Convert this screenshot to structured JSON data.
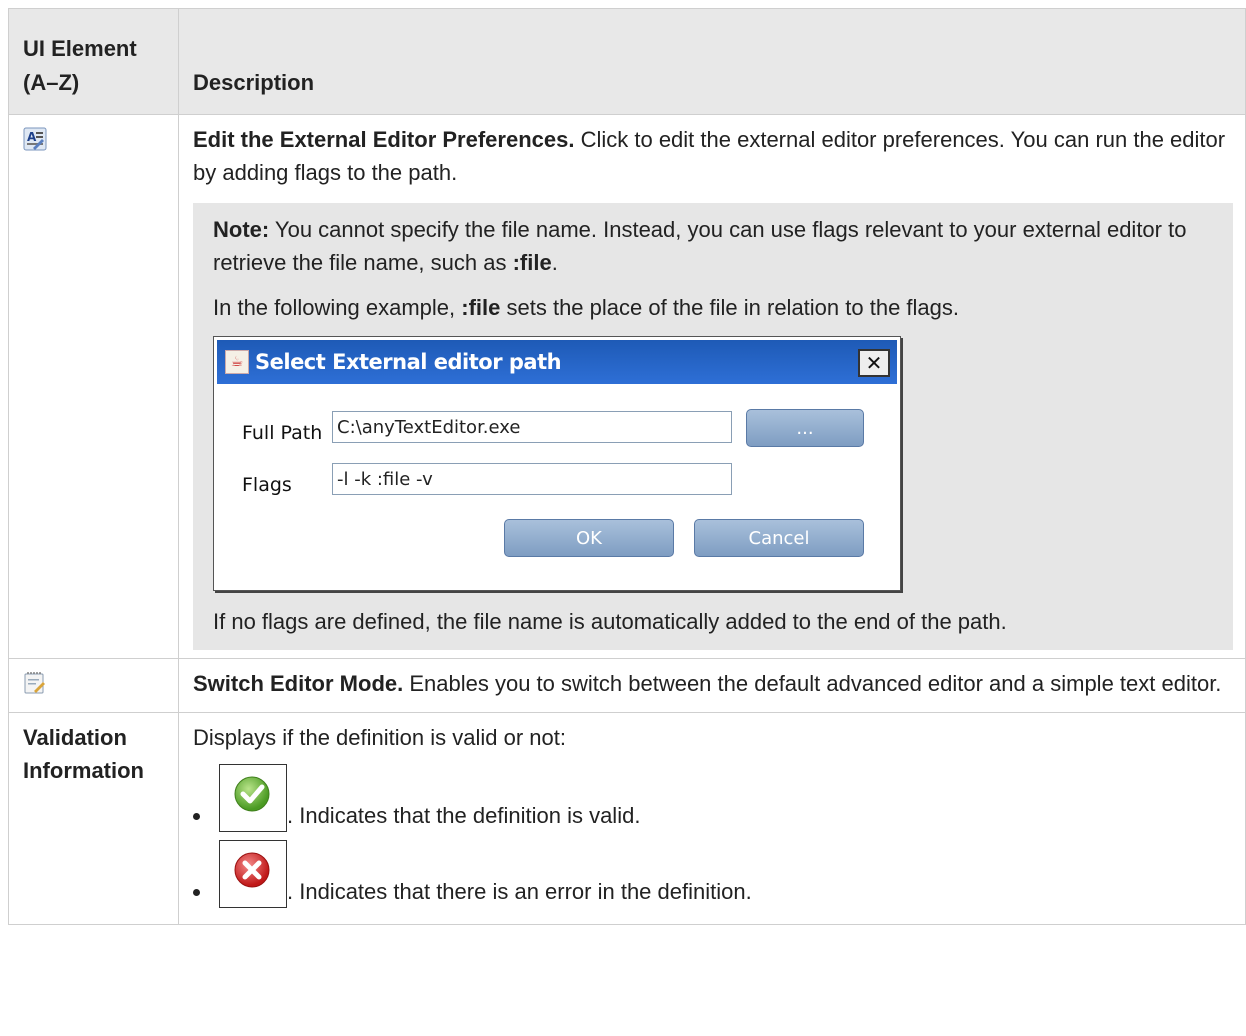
{
  "header": {
    "col1": "UI Element (A–Z)",
    "col2": "Description"
  },
  "rows": {
    "edit_external": {
      "icon": "edit-external-editor-icon",
      "title": "Edit the External Editor Preferences.",
      "text": " Click to edit the external editor preferences. You can run the editor by adding flags to the path.",
      "note": {
        "label": "Note:",
        "text1": " You cannot specify the file name. Instead, you can use flags relevant to your external editor to retrieve the file name, such as ",
        "flag1": ":file",
        "text1_end": ".",
        "p2_start": "In the following example, ",
        "flag2": ":file",
        "p2_end": " sets the place of the file in relation to the flags.",
        "dialog": {
          "title": "Select External editor path",
          "full_path_label": "Full Path",
          "full_path_value": "C:\\anyTextEditor.exe",
          "flags_label": "Flags",
          "flags_value": "-l -k :file -v",
          "browse_label": "...",
          "ok_label": "OK",
          "cancel_label": "Cancel"
        },
        "footer": "If no flags are defined, the file name is automatically added to the end of the path."
      }
    },
    "switch_mode": {
      "icon": "switch-editor-mode-icon",
      "title": "Switch Editor Mode.",
      "text": " Enables you to switch between the default advanced editor and a simple text editor."
    },
    "validation": {
      "label": "Validation Information",
      "intro": "Displays if the definition is valid or not:",
      "items": [
        {
          "icon": "green-check-icon",
          "text": ". Indicates that the definition is valid."
        },
        {
          "icon": "red-x-icon",
          "text": ". Indicates that there is an error in the definition."
        }
      ]
    }
  }
}
